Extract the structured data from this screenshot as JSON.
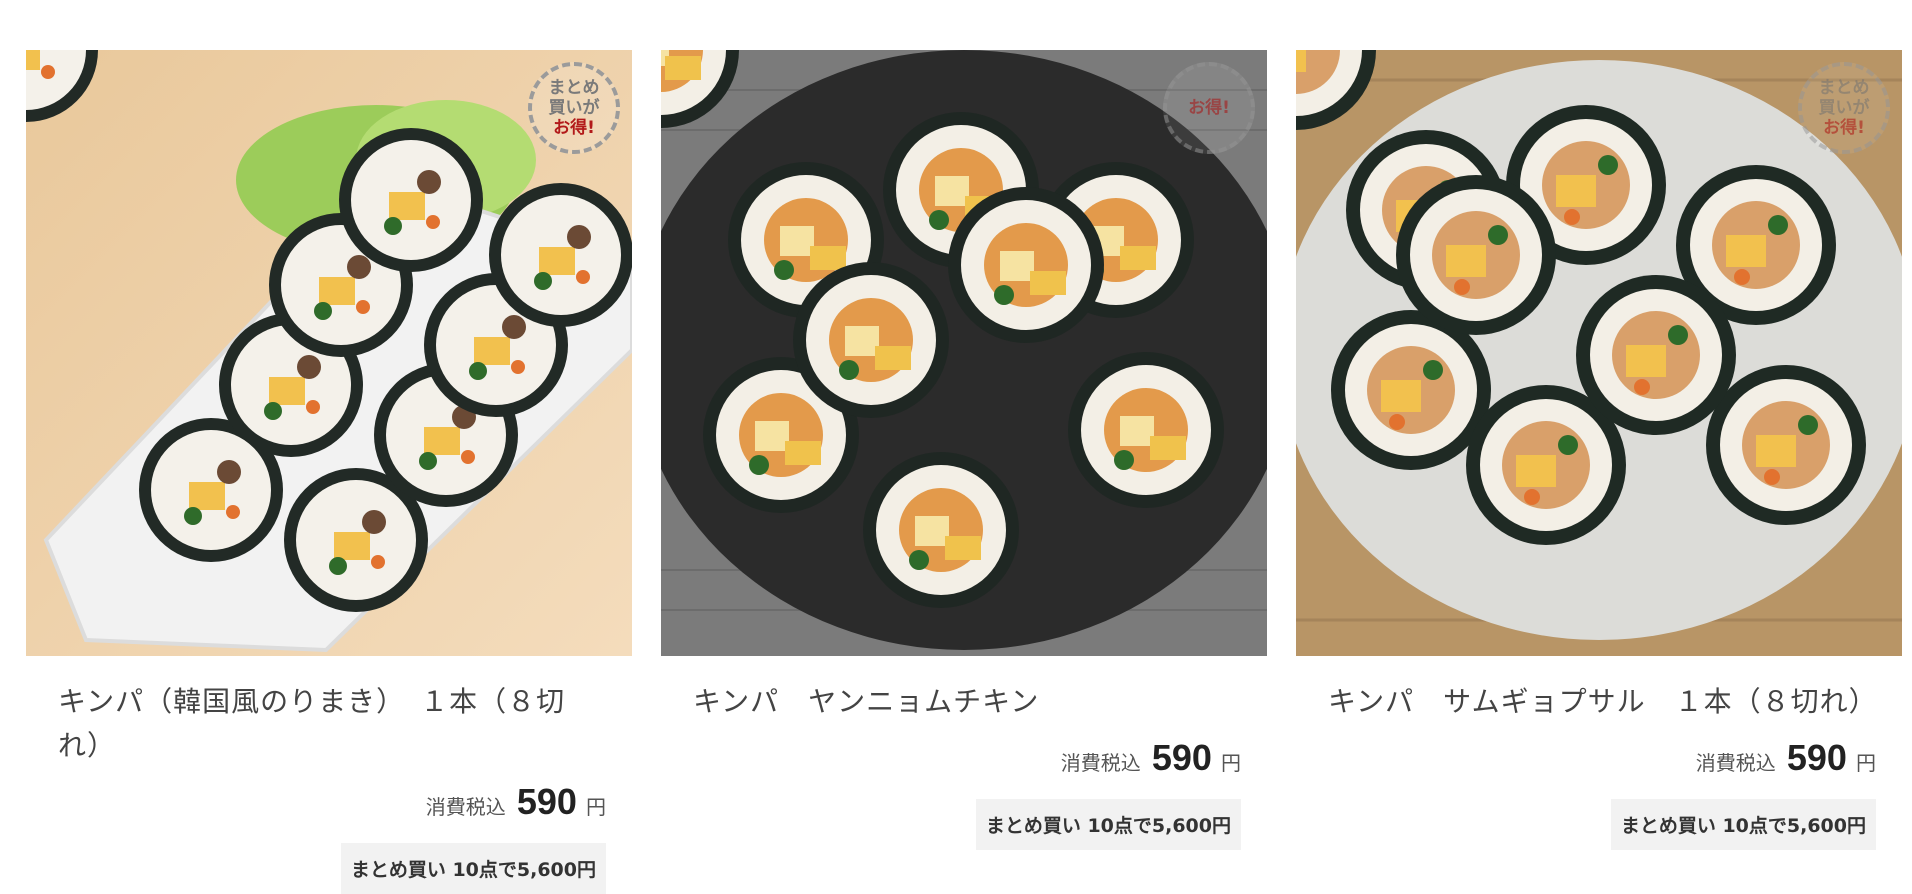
{
  "products": [
    {
      "name": "キンパ（韓国風のりまき）　１本（８切れ）",
      "badge": {
        "line1": "まとめ",
        "line2": "買いが",
        "line3": "お得!"
      },
      "tax_label": "消費税込",
      "price": "590",
      "currency": "円",
      "bulk_offer": "まとめ買い 10点で5,600円",
      "image_icon": "kimbap-plate-photo"
    },
    {
      "name": "キンパ　ヤンニョムチキン",
      "badge": {
        "line1": "",
        "line2": "",
        "line3": "お得!"
      },
      "tax_label": "消費税込",
      "price": "590",
      "currency": "円",
      "bulk_offer": "まとめ買い 10点で5,600円",
      "image_icon": "kimbap-plate-photo"
    },
    {
      "name": "キンパ　サムギョプサル　１本（８切れ）",
      "badge": {
        "line1": "まとめ",
        "line2": "買いが",
        "line3": "お得!"
      },
      "tax_label": "消費税込",
      "price": "590",
      "currency": "円",
      "bulk_offer": "まとめ買い 10点で5,600円",
      "image_icon": "kimbap-plate-photo"
    }
  ]
}
